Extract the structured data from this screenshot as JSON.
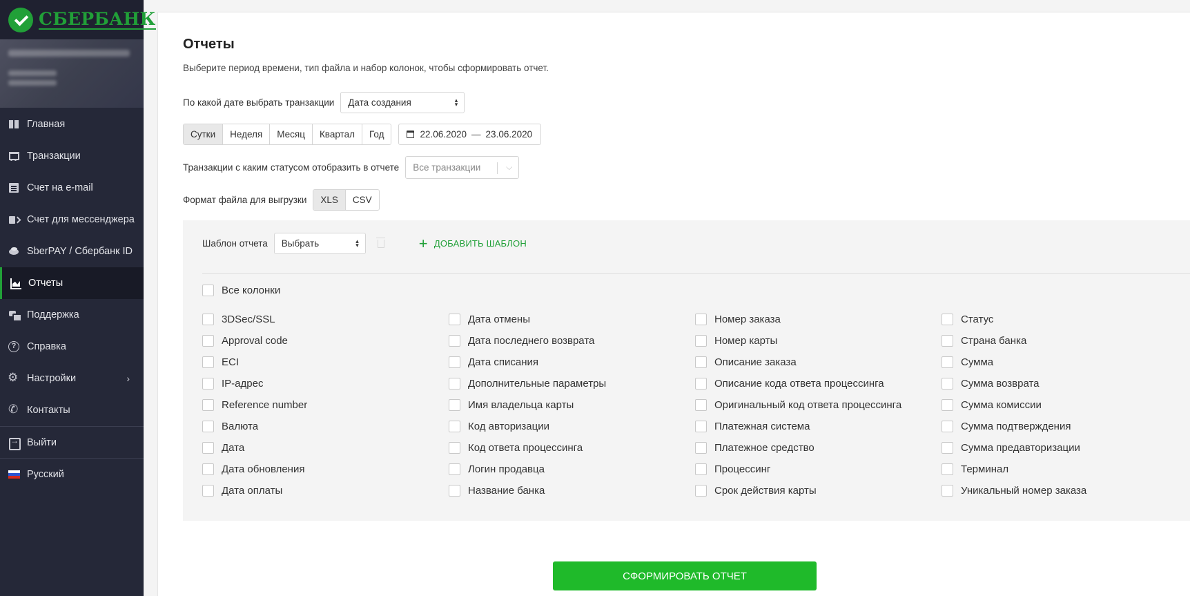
{
  "brand": {
    "name": "СБЕРБАНК",
    "color": "#21a038"
  },
  "sidebar": {
    "items": [
      {
        "label": "Главная",
        "icon": "dashboard-icon"
      },
      {
        "label": "Транзакции",
        "icon": "cart-icon"
      },
      {
        "label": "Счет на e-mail",
        "icon": "invoice-icon"
      },
      {
        "label": "Счет для мессенджера",
        "icon": "share-icon"
      },
      {
        "label": "SberPAY / Сбербанк ID",
        "icon": "coins-icon"
      },
      {
        "label": "Отчеты",
        "icon": "chart-icon",
        "active": true
      },
      {
        "label": "Поддержка",
        "icon": "chat-icon"
      },
      {
        "label": "Справка",
        "icon": "help-icon"
      },
      {
        "label": "Настройки",
        "icon": "gear-icon"
      },
      {
        "label": "Контакты",
        "icon": "phone-icon"
      },
      {
        "label": "Выйти",
        "icon": "exit-icon"
      },
      {
        "label": "Русский",
        "icon": "russian-flag-icon"
      }
    ],
    "settings_chevron": "›"
  },
  "page": {
    "title": "Отчеты",
    "subtitle": "Выберите период времени, тип файла и набор колонок, чтобы сформировать отчет."
  },
  "filters": {
    "date_by_label": "По какой дате выбрать транзакции",
    "date_by_value": "Дата создания",
    "periods": [
      "Сутки",
      "Неделя",
      "Месяц",
      "Квартал",
      "Год"
    ],
    "period_selected": "Сутки",
    "date_from": "22.06.2020",
    "date_sep": "—",
    "date_to": "23.06.2020",
    "status_label": "Транзакции с каким статусом отобразить в отчете",
    "status_placeholder": "Все транзакции",
    "format_label": "Формат файла для выгрузки",
    "formats": [
      "XLS",
      "CSV"
    ],
    "format_selected": "XLS"
  },
  "template": {
    "label": "Шаблон отчета",
    "value": "Выбрать",
    "add_label": "ДОБАВИТЬ ШАБЛОН"
  },
  "columns": {
    "all_label": "Все колонки",
    "col1": [
      "3DSec/SSL",
      "Approval code",
      "ECI",
      "IP-адрес",
      "Reference number",
      "Валюта",
      "Дата",
      "Дата обновления",
      "Дата оплаты"
    ],
    "col2": [
      "Дата отмены",
      "Дата последнего возврата",
      "Дата списания",
      "Дополнительные параметры",
      "Имя владельца карты",
      "Код авторизации",
      "Код ответа процессинга",
      "Логин продавца",
      "Название банка"
    ],
    "col3": [
      "Номер заказа",
      "Номер карты",
      "Описание заказа",
      "Описание кода ответа процессинга",
      "Оригинальный код ответа процессинга",
      "Платежная система",
      "Платежное средство",
      "Процессинг",
      "Срок действия карты"
    ],
    "col4": [
      "Статус",
      "Страна банка",
      "Сумма",
      "Сумма возврата",
      "Сумма комиссии",
      "Сумма подтверждения",
      "Сумма предавторизации",
      "Терминал",
      "Уникальный номер заказа"
    ]
  },
  "submit_label": "СФОРМИРОВАТЬ ОТЧЕТ",
  "colors": {
    "sidebar_bg": "#252838",
    "accent": "#21a038",
    "button": "#1fba2a"
  }
}
